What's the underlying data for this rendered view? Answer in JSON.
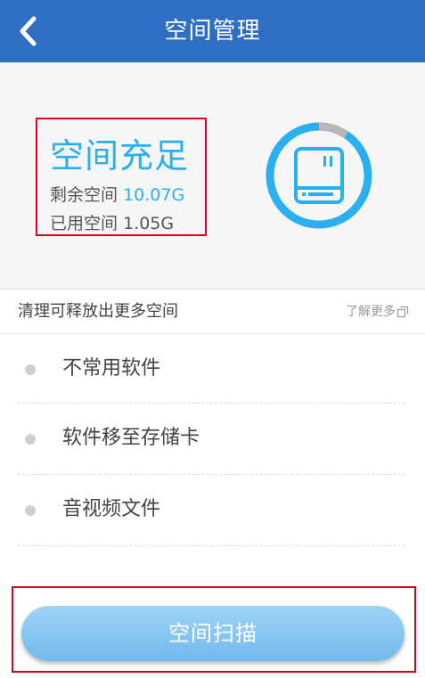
{
  "header": {
    "title": "空间管理",
    "back_icon": "chevron-left-icon"
  },
  "status": {
    "headline": "空间充足",
    "free_label": "剩余空间",
    "free_value": "10.07G",
    "used_label": "已用空间",
    "used_value": "1.05G",
    "used_fraction": 0.094,
    "ring_color": "#2ab0ee",
    "ring_used_color": "#b8b8b8",
    "icon": "storage-drive-icon"
  },
  "section": {
    "title": "清理可释放出更多空间",
    "learn_more": "了解更多",
    "learn_more_icon": "copy-icon"
  },
  "options": [
    {
      "label": "不常用软件"
    },
    {
      "label": "软件移至存储卡"
    },
    {
      "label": "音视频文件"
    }
  ],
  "scan_button": {
    "label": "空间扫描"
  },
  "colors": {
    "app_bar": "#2f6fc3",
    "accent": "#2ab0ee",
    "highlight_border": "#d9001b"
  }
}
